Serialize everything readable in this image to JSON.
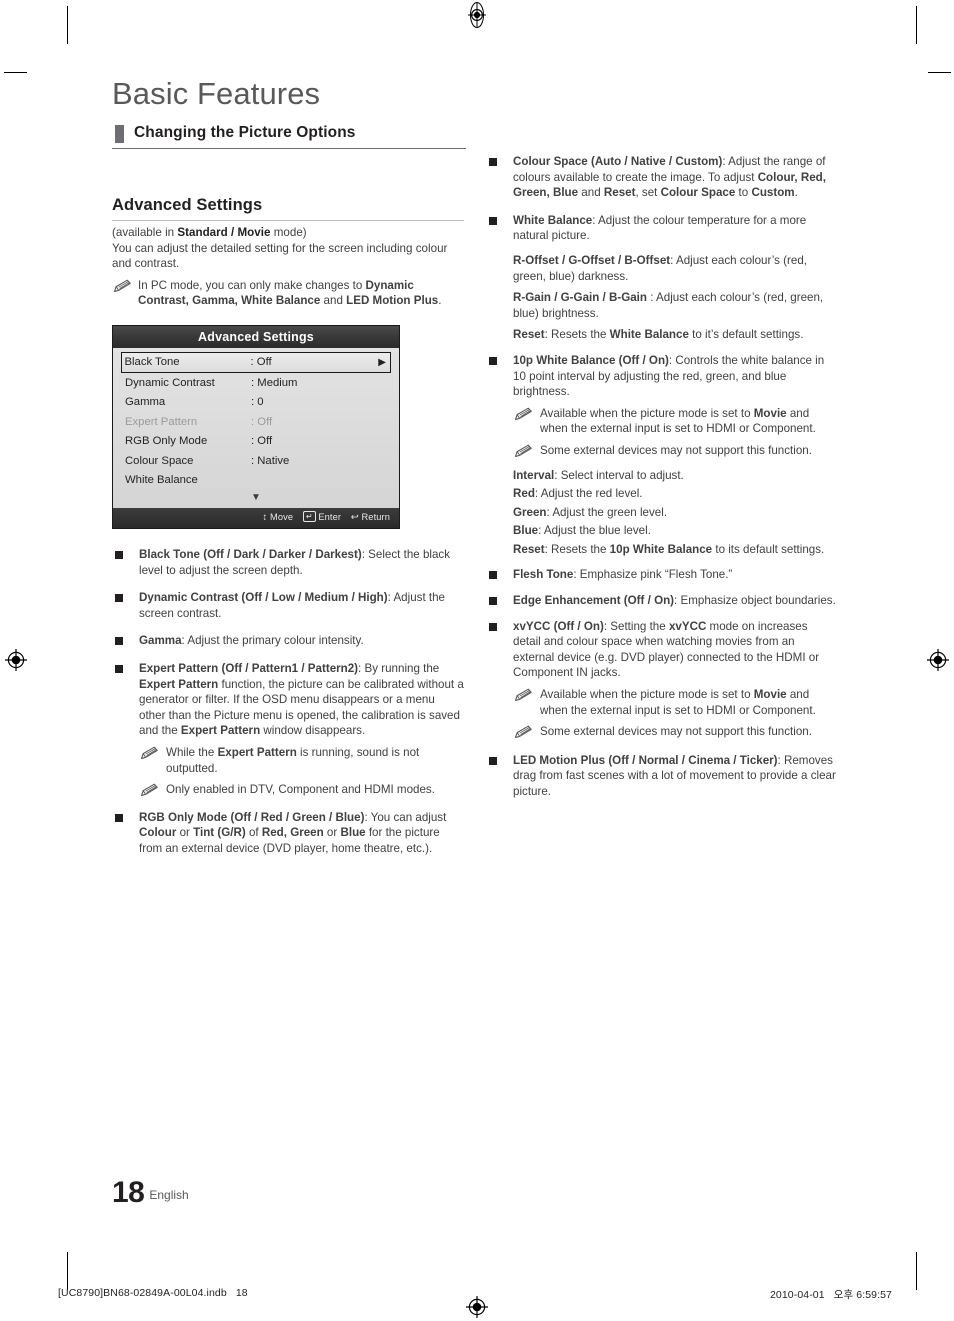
{
  "document": {
    "chapter_title": "Basic Features",
    "section_tab_label": "Changing the Picture Options",
    "page_number": "18",
    "language": "English"
  },
  "left_column": {
    "sub_head": "Advanced Settings",
    "intro_line1_a": "(available in ",
    "intro_line1_b": "Standard / Movie",
    "intro_line1_c": " mode)",
    "intro_line2": "You can adjust the detailed setting for the screen including colour and contrast.",
    "pc_note_a": "In PC mode, you can only make changes to ",
    "pc_note_b": "Dynamic Contrast, Gamma, White Balance",
    "pc_note_c": " and ",
    "pc_note_d": "LED Motion Plus",
    "pc_note_e": ".",
    "osd": {
      "title": "Advanced Settings",
      "rows": [
        {
          "label": "Black Tone",
          "value": ": Off",
          "selected": true,
          "dim": false,
          "arrow": "▶"
        },
        {
          "label": "Dynamic Contrast",
          "value": ": Medium",
          "selected": false,
          "dim": false,
          "arrow": ""
        },
        {
          "label": "Gamma",
          "value": ": 0",
          "selected": false,
          "dim": false,
          "arrow": ""
        },
        {
          "label": "Expert Pattern",
          "value": ": Off",
          "selected": false,
          "dim": true,
          "arrow": ""
        },
        {
          "label": "RGB Only Mode",
          "value": ": Off",
          "selected": false,
          "dim": false,
          "arrow": ""
        },
        {
          "label": "Colour Space",
          "value": ": Native",
          "selected": false,
          "dim": false,
          "arrow": ""
        },
        {
          "label": "White Balance",
          "value": "",
          "selected": false,
          "dim": false,
          "arrow": ""
        }
      ],
      "scroll_glyph": "▼",
      "footer": {
        "move_glyph": "↕",
        "move_label": "Move",
        "enter_glyph": "↵",
        "enter_label": "Enter",
        "return_glyph": "↩",
        "return_label": "Return"
      }
    },
    "bullets": [
      {
        "bold": "Black Tone (Off / Dark / Darker / Darkest)",
        "rest": ": Select the black level to adjust the screen depth."
      },
      {
        "bold": "Dynamic Contrast (Off / Low / Medium / High)",
        "rest": ": Adjust the screen contrast."
      },
      {
        "bold": "Gamma",
        "rest": ": Adjust the primary colour intensity."
      }
    ],
    "expert_pattern": {
      "bold1": "Expert Pattern (Off / Pattern1 / Pattern2)",
      "t1": ": By running the ",
      "bold2": "Expert Pattern",
      "t2": " function, the picture can be calibrated without a generator or filter. If the OSD menu disappears or a menu other than the Picture menu is opened, the calibration is saved and the ",
      "bold3": "Expert Pattern",
      "t3": " window disappears.",
      "note1_a": "While the ",
      "note1_b": "Expert Pattern",
      "note1_c": " is running, sound is not outputted.",
      "note2": "Only enabled in DTV, Component and HDMI modes."
    },
    "rgb_only": {
      "bold1": "RGB Only Mode (Off / Red / Green / Blue)",
      "t1": ": You can adjust ",
      "bold2": "Colour",
      "t2": " or ",
      "bold3": "Tint (G/R)",
      "t3": " of ",
      "bold4": "Red, Green",
      "t4": " or ",
      "bold5": "Blue",
      "t5": " for the picture from an external device (DVD player, home theatre, etc.)."
    }
  },
  "right_column": {
    "colour_space": {
      "bold1": "Colour Space (Auto / Native / Custom)",
      "t1": ": Adjust the range of colours available to create the image. To adjust ",
      "bold2": "Colour, Red, Green, Blue",
      "t2": " and ",
      "bold3": "Reset",
      "t3": ", set ",
      "bold4": "Colour Space",
      "t4": " to ",
      "bold5": "Custom",
      "t5": "."
    },
    "white_balance": {
      "bold1": "White Balance",
      "t1": ": Adjust the colour temperature for a more natural picture.",
      "sub1_bold": "R-Offset / G-Offset / B-Offset",
      "sub1_rest": ": Adjust each colour’s (red, green, blue) darkness.",
      "sub2_bold": "R-Gain / G-Gain / B-Gain",
      "sub2_rest": " : Adjust each colour’s (red, green, blue) brightness.",
      "sub3_bold": "Reset",
      "sub3_a": ": Resets the ",
      "sub3_bold2": "White Balance",
      "sub3_b": " to it’s default settings."
    },
    "wb10p": {
      "bold1": "10p White Balance (Off / On)",
      "t1": ": Controls the white balance in 10 point interval by adjusting the red, green, and blue brightness.",
      "note1_a": "Available when the picture mode is set to ",
      "note1_b": "Movie",
      "note1_c": " and when the external input is set to HDMI or Component.",
      "note2": "Some external devices may not support this function.",
      "sub_interval_bold": "Interval",
      "sub_interval_rest": ": Select interval to adjust.",
      "sub_red_bold": "Red",
      "sub_red_rest": ": Adjust the red level.",
      "sub_green_bold": "Green",
      "sub_green_rest": ": Adjust the green level.",
      "sub_blue_bold": "Blue",
      "sub_blue_rest": ": Adjust the blue level.",
      "sub_reset_bold": "Reset",
      "sub_reset_a": ": Resets the ",
      "sub_reset_bold2": "10p White Balance",
      "sub_reset_b": " to its default settings."
    },
    "flesh_tone": {
      "bold1": "Flesh Tone",
      "t1": ": Emphasize pink “Flesh Tone.”"
    },
    "edge_enhancement": {
      "bold1": "Edge Enhancement (Off / On)",
      "t1": ": Emphasize object boundaries."
    },
    "xvycc": {
      "bold1": "xvYCC (Off / On)",
      "t1": ": Setting the ",
      "bold2": "xvYCC",
      "t2": " mode on increases detail and colour space when watching movies from an external device (e.g. DVD player) connected to the HDMI or Component IN jacks.",
      "note1_a": "Available when the picture mode is set to ",
      "note1_b": "Movie",
      "note1_c": " and when the external input is set to HDMI or Component.",
      "note2": "Some external devices may not support this function."
    },
    "led_motion_plus": {
      "bold1": "LED Motion Plus (Off / Normal / Cinema / Ticker)",
      "t1": ": Removes drag from fast scenes with a lot of movement to provide a clear picture."
    }
  },
  "print_slug": {
    "left": "[UC8790]BN68-02849A-00L04.indb   18",
    "right": "2010-04-01   오후 6:59:57"
  }
}
